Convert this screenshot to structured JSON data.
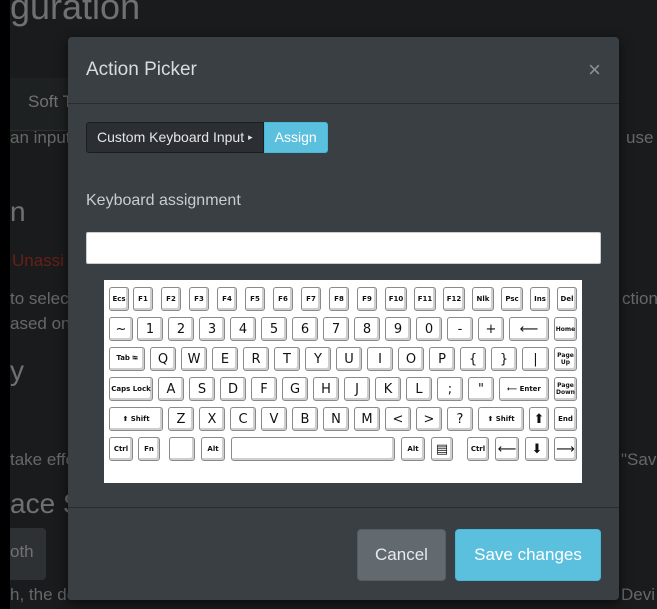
{
  "background": {
    "title": "guration",
    "tab_label": "Soft T",
    "line_input": "an input,",
    "line_use": "use",
    "line_n": "n",
    "unassigned": "Unassi",
    "line_selec": "to selec",
    "line_action": "ction g",
    "line_based": "ased on",
    "line_y": "y",
    "line_take": "take effe",
    "line_sav": "\"Sav",
    "heading_space": "ace S",
    "btn_both": "oth",
    "line_bottom": "h, the de",
    "line_devi": "Devi"
  },
  "modal": {
    "title": "Action Picker",
    "close_glyph": "×",
    "dropdown_label": "Custom Keyboard Input",
    "dropdown_caret": "▸",
    "assign_label": "Assign",
    "keyboard_label": "Keyboard assignment",
    "keyboard_value": "",
    "cancel_label": "Cancel",
    "save_label": "Save changes"
  },
  "keyboard": {
    "row1": [
      "Ecs",
      "F1",
      "F2",
      "F3",
      "F4",
      "F5",
      "F6",
      "F7",
      "F8",
      "F9",
      "F10",
      "F11",
      "F12",
      "Nlk",
      "Psc",
      "Ins",
      "Del"
    ],
    "row2": [
      "~",
      "1",
      "2",
      "3",
      "4",
      "5",
      "6",
      "7",
      "8",
      "9",
      "0",
      "-",
      "+",
      "⟵",
      "Home"
    ],
    "row3": [
      "Tab ⭾",
      "Q",
      "W",
      "E",
      "R",
      "T",
      "Y",
      "U",
      "I",
      "O",
      "P",
      "{",
      "}",
      "|",
      "Page Up"
    ],
    "row4": [
      "Caps Lock",
      "A",
      "S",
      "D",
      "F",
      "G",
      "H",
      "J",
      "K",
      "L",
      ";",
      "\"",
      "⟵ Enter",
      "Page Down"
    ],
    "row5": [
      "⬆ Shift",
      "Z",
      "X",
      "C",
      "V",
      "B",
      "N",
      "M",
      "<",
      ">",
      "?",
      "⬆ Shift",
      "⬆",
      "End"
    ],
    "row6": [
      "Ctrl",
      "Fn",
      "",
      "Alt",
      "",
      "Alt",
      "▤",
      "Ctrl",
      "⟵",
      "⬇",
      "⟶"
    ]
  }
}
